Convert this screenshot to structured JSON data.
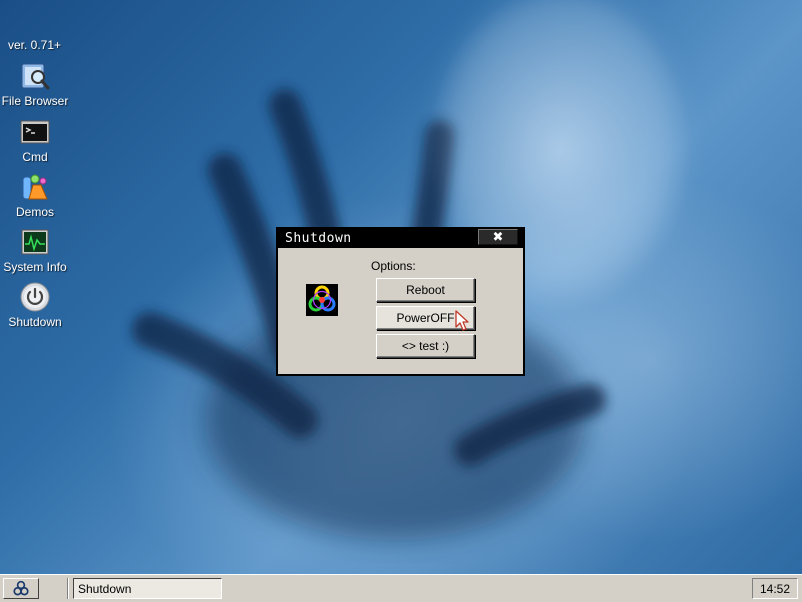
{
  "desktop": {
    "version": "ver. 0.71+",
    "icons": [
      {
        "label": "File Browser",
        "icon": "file-browser-icon"
      },
      {
        "label": "Cmd",
        "icon": "terminal-icon"
      },
      {
        "label": "Demos",
        "icon": "demos-icon"
      },
      {
        "label": "System Info",
        "icon": "system-info-icon"
      },
      {
        "label": "Shutdown",
        "icon": "power-icon"
      }
    ]
  },
  "dialog": {
    "title": "Shutdown",
    "close_label": "✖",
    "options_label": "Options:",
    "icon": "biohazard-icon",
    "buttons": [
      {
        "label": "Reboot"
      },
      {
        "label": "PowerOFF"
      },
      {
        "label": "<> test :)"
      }
    ]
  },
  "taskbar": {
    "start_icon": "biohazard-icon",
    "tasks": [
      {
        "label": "Shutdown"
      }
    ],
    "clock": "14:52"
  },
  "colors": {
    "dialog_bg": "#d4d0c8",
    "titlebar": "#000000",
    "desktop_accent": "#2f6ea8"
  }
}
